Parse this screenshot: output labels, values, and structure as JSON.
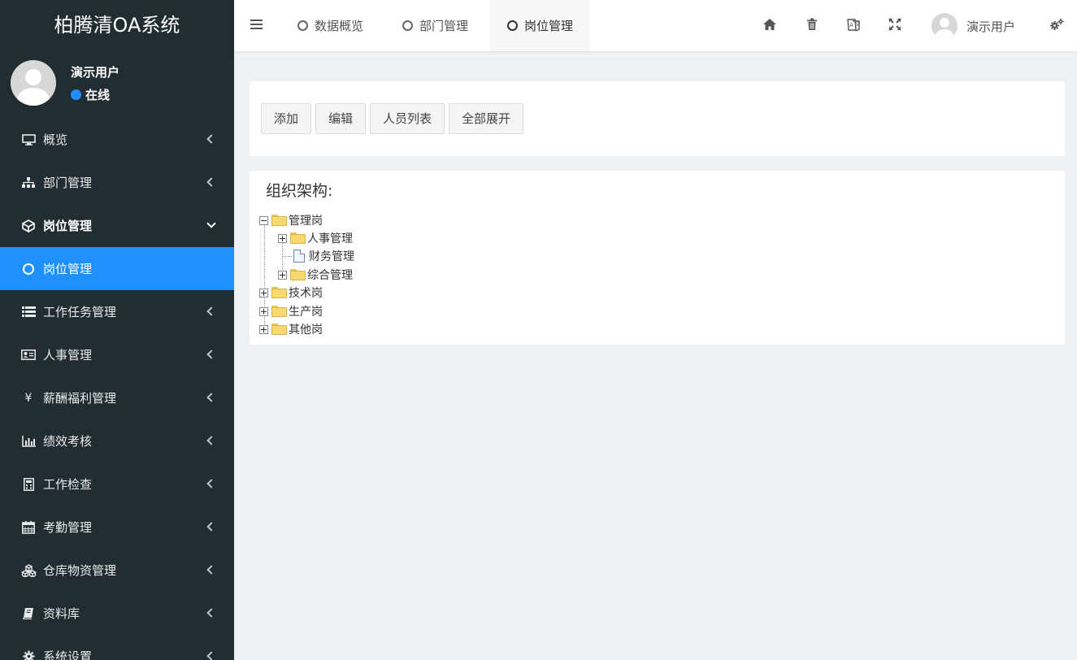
{
  "app": {
    "title": "柏腾清OA系统"
  },
  "user": {
    "name": "演示用户",
    "status": "在线"
  },
  "sidebar": {
    "items": [
      {
        "label": "概览",
        "icon": "monitor-icon"
      },
      {
        "label": "部门管理",
        "icon": "sitemap-icon"
      },
      {
        "label": "岗位管理",
        "icon": "cube-icon",
        "open": true
      },
      {
        "label": "岗位管理",
        "icon": "circle-icon",
        "active": true
      },
      {
        "label": "工作任务管理",
        "icon": "list-icon"
      },
      {
        "label": "人事管理",
        "icon": "id-card-icon"
      },
      {
        "label": "薪酬福利管理",
        "icon": "yen-icon"
      },
      {
        "label": "绩效考核",
        "icon": "bar-chart-icon"
      },
      {
        "label": "工作检查",
        "icon": "calculator-icon"
      },
      {
        "label": "考勤管理",
        "icon": "calendar-icon"
      },
      {
        "label": "仓库物资管理",
        "icon": "cubes-icon"
      },
      {
        "label": "资料库",
        "icon": "book-icon"
      },
      {
        "label": "系统设置",
        "icon": "gear-icon"
      }
    ]
  },
  "topbar": {
    "tabs": [
      {
        "label": "数据概览"
      },
      {
        "label": "部门管理"
      },
      {
        "label": "岗位管理",
        "current": true
      }
    ],
    "icons": [
      "home-icon",
      "trash-icon",
      "translate-icon",
      "fullscreen-icon",
      "gears-icon"
    ],
    "user_name": "演示用户"
  },
  "toolbar": {
    "add": "添加",
    "edit": "编辑",
    "staff_list": "人员列表",
    "expand_all": "全部展开"
  },
  "tree": {
    "title": "组织架构:",
    "nodes": [
      {
        "label": "管理岗",
        "expanded": true
      },
      {
        "label": "人事管理"
      },
      {
        "label": "财务管理"
      },
      {
        "label": "综合管理"
      },
      {
        "label": "技术岗"
      },
      {
        "label": "生产岗"
      },
      {
        "label": "其他岗"
      }
    ]
  },
  "colors": {
    "sidebar_bg": "#222d32",
    "accent": "#1e90ff",
    "content_bg": "#eff2f5"
  }
}
